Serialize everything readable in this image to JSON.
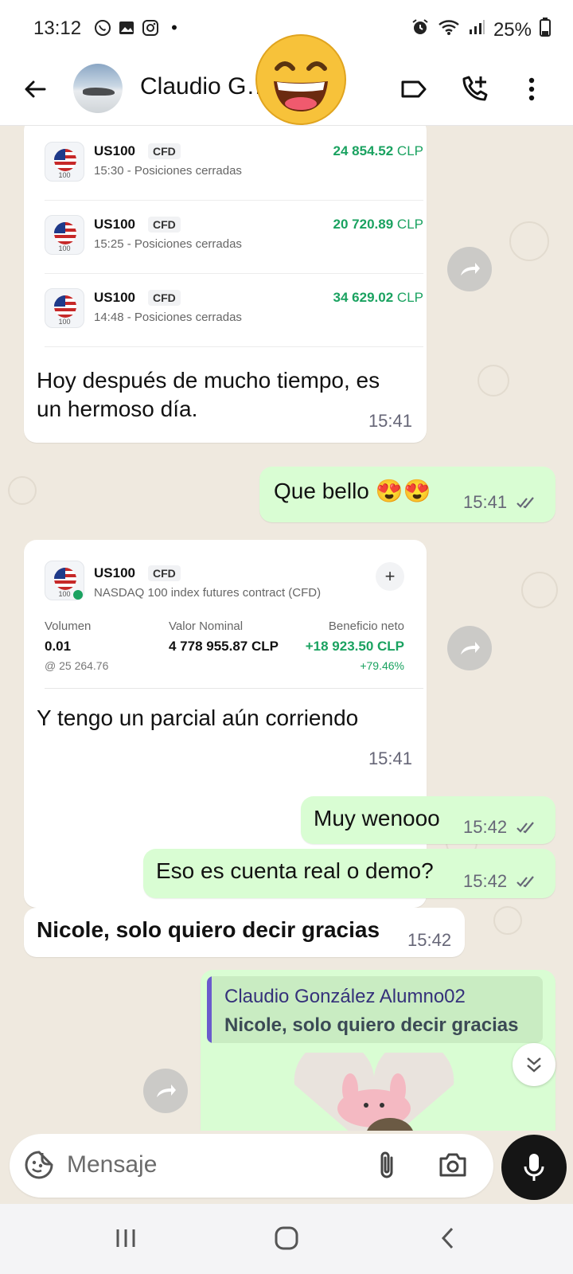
{
  "status_bar": {
    "time": "13:12",
    "battery": "25%",
    "dot": "•"
  },
  "header": {
    "contact_name": "Claudio González Alumno02",
    "contact_name_display": "Claudio G…   A…",
    "icons": [
      "back-arrow-icon",
      "label-icon",
      "add-call-icon",
      "more-vert-icon"
    ]
  },
  "messages": {
    "trade_list": {
      "rows": [
        {
          "symbol": "US100",
          "badge": "CFD",
          "subtitle": "15:30 - Posiciones cerradas",
          "amount": "24 854.52",
          "currency": "CLP"
        },
        {
          "symbol": "US100",
          "badge": "CFD",
          "subtitle": "15:25 - Posiciones cerradas",
          "amount": "20 720.89",
          "currency": "CLP"
        },
        {
          "symbol": "US100",
          "badge": "CFD",
          "subtitle": "14:48 - Posiciones cerradas",
          "amount": "34 629.02",
          "currency": "CLP"
        }
      ],
      "flag_label": "100",
      "text_line1": "Hoy después de mucho tiempo, es",
      "text_line2": "un hermoso día.",
      "time": "15:41"
    },
    "out1": {
      "text": "Que bello 😍😍",
      "time": "15:41"
    },
    "position_card": {
      "symbol": "US100",
      "badge": "CFD",
      "description": "NASDAQ 100 index futures contract (CFD)",
      "flag_label": "100",
      "plus": "+",
      "volumen_label": "Volumen",
      "volumen_value": "0.01",
      "volumen_sub": "@ 25 264.76",
      "nominal_label": "Valor Nominal",
      "nominal_value": "4 778 955.87 CLP",
      "profit_label": "Beneficio neto",
      "profit_value": "+18 923.50 CLP",
      "profit_pct": "+79.46%",
      "text": "Y tengo un parcial aún corriendo",
      "time": "15:41"
    },
    "out2": {
      "text": "Muy wenooo",
      "time": "15:42"
    },
    "out3": {
      "text": "Eso es cuenta real o demo?",
      "time": "15:42"
    },
    "in3": {
      "text": "Nicole, solo quiero decir gracias",
      "time": "15:42"
    },
    "reply": {
      "quoted_author": "Claudio González Alumno02",
      "quoted_text": "Nicole, solo quiero decir gracias"
    }
  },
  "input": {
    "placeholder": "Mensaje"
  },
  "colors": {
    "accent_green": "#1aa260",
    "outgoing_bubble": "#d9fdd3",
    "read_ticks": "#53bdeb",
    "quote_bar": "#6a5acd"
  }
}
